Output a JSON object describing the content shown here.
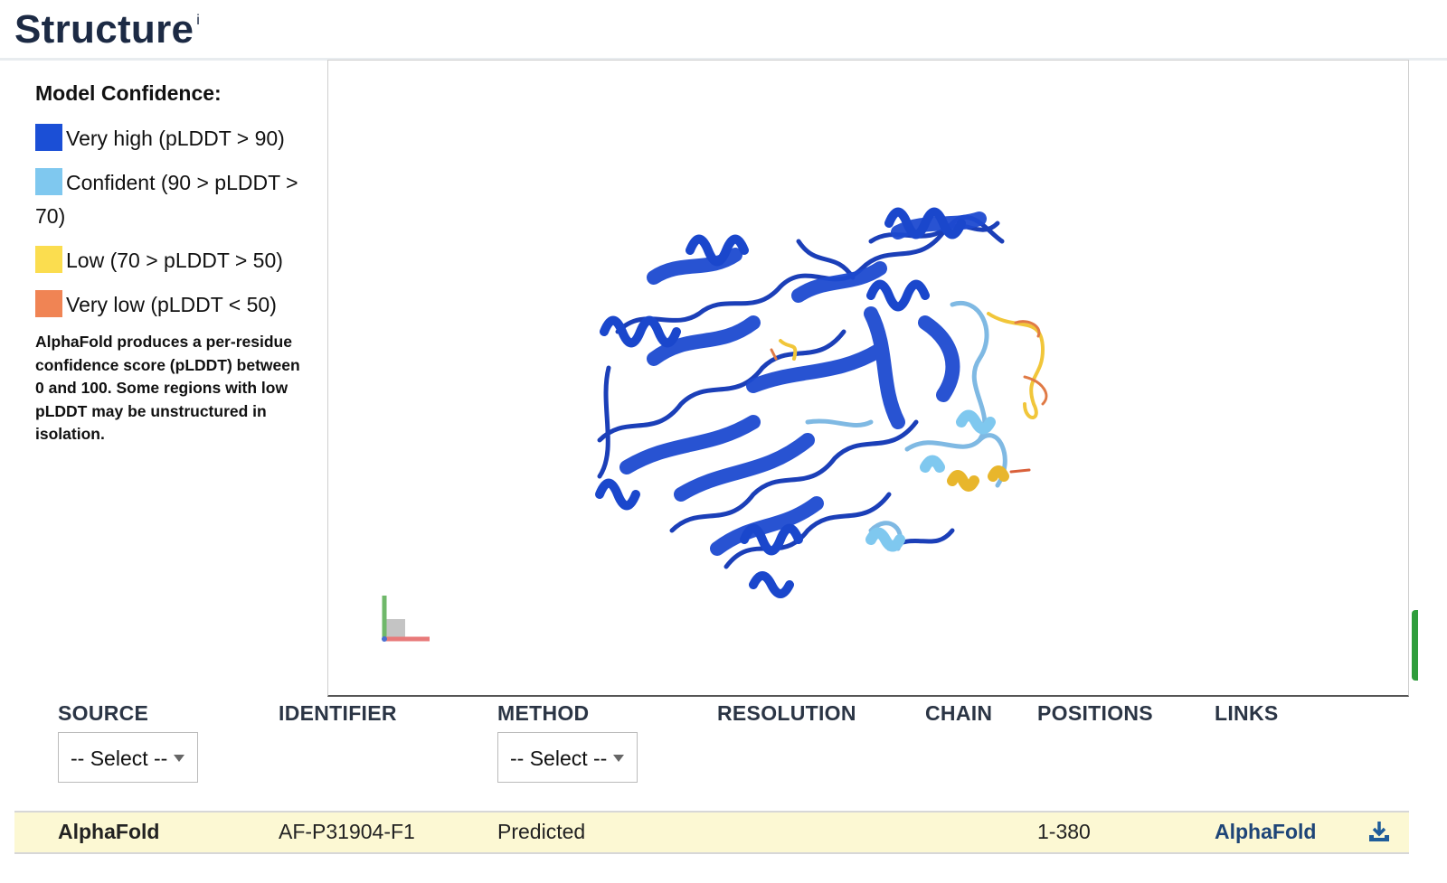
{
  "section": {
    "title": "Structure",
    "info_marker": "i"
  },
  "legend": {
    "title": "Model Confidence:",
    "items": [
      {
        "label": "Very high (pLDDT > 90)",
        "color": "#1b4fd6"
      },
      {
        "label": "Confident (90 > pLDDT > 70)",
        "color": "#7fc8ef"
      },
      {
        "label": "Low (70 > pLDDT > 50)",
        "color": "#fbdd4f"
      },
      {
        "label": "Very low (pLDDT < 50)",
        "color": "#f08454"
      }
    ],
    "note": "AlphaFold produces a per-residue confidence score (pLDDT) between 0 and 100. Some regions with low pLDDT may be unstructured in isolation."
  },
  "viewer": {
    "axes_icon": "axes-gizmo-icon"
  },
  "table": {
    "headers": {
      "source": "SOURCE",
      "identifier": "IDENTIFIER",
      "method": "METHOD",
      "resolution": "RESOLUTION",
      "chain": "CHAIN",
      "positions": "POSITIONS",
      "links": "LINKS"
    },
    "filters": {
      "source": "-- Select --",
      "method": "-- Select --"
    },
    "rows": [
      {
        "source": "AlphaFold",
        "identifier": "AF-P31904-F1",
        "method": "Predicted",
        "resolution": "",
        "chain": "",
        "positions": "1-380",
        "link": "AlphaFold",
        "download_icon": "download-icon"
      }
    ]
  }
}
